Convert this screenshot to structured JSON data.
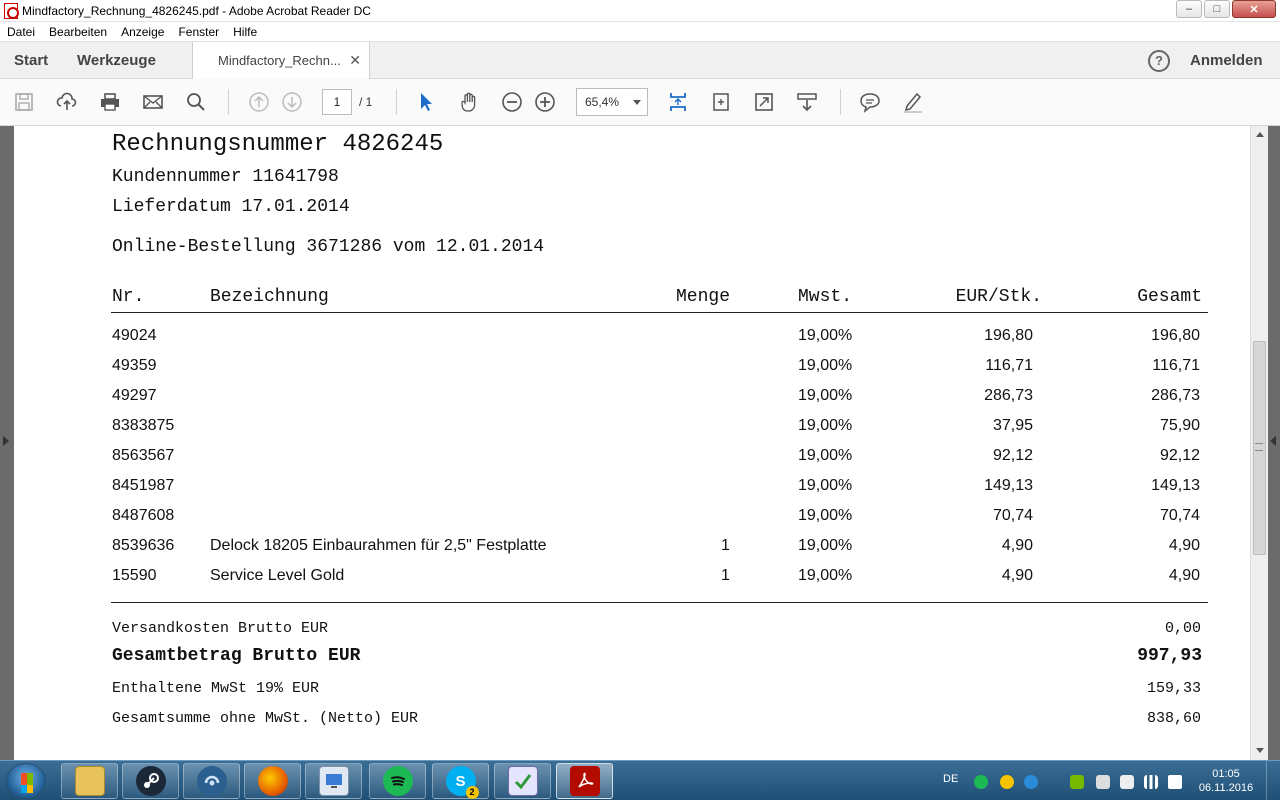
{
  "window": {
    "title": "Mindfactory_Rechnung_4826245.pdf - Adobe Acrobat Reader DC",
    "minimize": "–",
    "maximize": "□",
    "close": "✕"
  },
  "menu": [
    "Datei",
    "Bearbeiten",
    "Anzeige",
    "Fenster",
    "Hilfe"
  ],
  "tabs": {
    "start": "Start",
    "tools": "Werkzeuge",
    "document": "Mindfactory_Rechn...",
    "document_close": "✕",
    "help": "?",
    "signin": "Anmelden"
  },
  "toolbar": {
    "page_current": "1",
    "page_total": "/ 1",
    "zoom": "65,4%"
  },
  "invoice": {
    "invoice_number": "Rechnungsnummer 4826245",
    "customer_number": "Kundennummer 11641798",
    "delivery_date": "Lieferdatum 17.01.2014",
    "order": "Online-Bestellung 3671286 vom 12.01.2014",
    "headers": {
      "nr": "Nr.",
      "desc": "Bezeichnung",
      "qty": "Menge",
      "vat": "Mwst.",
      "unit": "EUR/Stk.",
      "total": "Gesamt"
    },
    "rows": [
      {
        "nr": "49024",
        "desc": "",
        "qty": "",
        "vat": "19,00%",
        "unit": "196,80",
        "total": "196,80"
      },
      {
        "nr": "49359",
        "desc": "",
        "qty": "",
        "vat": "19,00%",
        "unit": "116,71",
        "total": "116,71"
      },
      {
        "nr": "49297",
        "desc": "",
        "qty": "",
        "vat": "19,00%",
        "unit": "286,73",
        "total": "286,73"
      },
      {
        "nr": "8383875",
        "desc": "",
        "qty": "",
        "vat": "19,00%",
        "unit": "37,95",
        "total": "75,90"
      },
      {
        "nr": "8563567",
        "desc": "",
        "qty": "",
        "vat": "19,00%",
        "unit": "92,12",
        "total": "92,12"
      },
      {
        "nr": "8451987",
        "desc": "",
        "qty": "",
        "vat": "19,00%",
        "unit": "149,13",
        "total": "149,13"
      },
      {
        "nr": "8487608",
        "desc": "",
        "qty": "",
        "vat": "19,00%",
        "unit": "70,74",
        "total": "70,74"
      },
      {
        "nr": "8539636",
        "desc": "Delock 18205 Einbaurahmen für 2,5\" Festplatte",
        "qty": "1",
        "vat": "19,00%",
        "unit": "4,90",
        "total": "4,90"
      },
      {
        "nr": "15590",
        "desc": "Service Level Gold",
        "qty": "1",
        "vat": "19,00%",
        "unit": "4,90",
        "total": "4,90"
      }
    ],
    "shipping_label": "Versandkosten Brutto EUR",
    "shipping_value": "0,00",
    "grand_label": "Gesamtbetrag Brutto EUR",
    "grand_value": "997,93",
    "vat_label": "Enthaltene MwSt 19% EUR",
    "vat_value": "159,33",
    "net_label": "Gesamtsumme ohne MwSt. (Netto) EUR",
    "net_value": "838,60"
  },
  "taskbar": {
    "apps": [
      "file-explorer-icon",
      "steam-icon",
      "teamspeak-icon",
      "firefox-icon",
      "remote-desktop-icon",
      "spotify-icon",
      "skype-icon",
      "checklist-icon",
      "acrobat-icon"
    ],
    "skype_badge": "2",
    "language": "DE",
    "time": "01:05",
    "date": "06.11.2016"
  },
  "colors": {
    "taskbar": "#1f4f75",
    "spotify": "#1db954",
    "acrobat": "#b30b00",
    "firefox": "#e66000",
    "skype": "#00aff0"
  }
}
